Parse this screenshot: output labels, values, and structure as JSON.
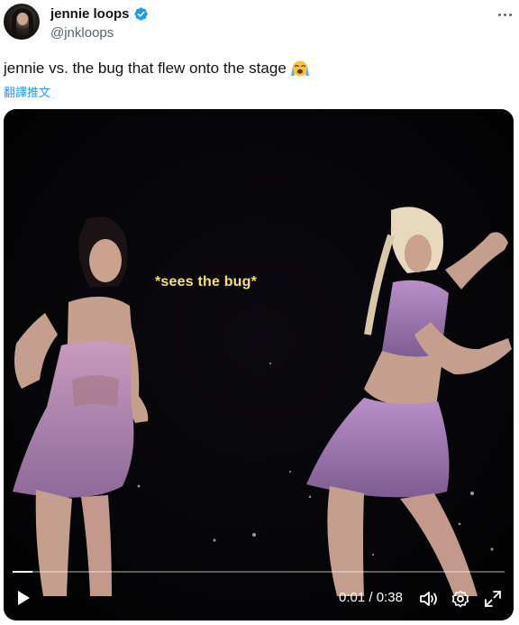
{
  "author": {
    "display_name": "jennie loops",
    "handle": "@jnkloops",
    "verified": true
  },
  "tweet": {
    "text": "jennie vs. the bug that flew onto the stage",
    "emoji": "loudly-crying-face",
    "translate_label": "翻譯推文"
  },
  "video": {
    "caption": "*sees the bug*",
    "current_time": "0:01",
    "separator": "/",
    "duration": "0:38",
    "progress": 0.04
  },
  "colors": {
    "accent": "#1d9bf0",
    "caption": "#f5e26a",
    "text": "#0f1419",
    "muted": "#536471"
  }
}
